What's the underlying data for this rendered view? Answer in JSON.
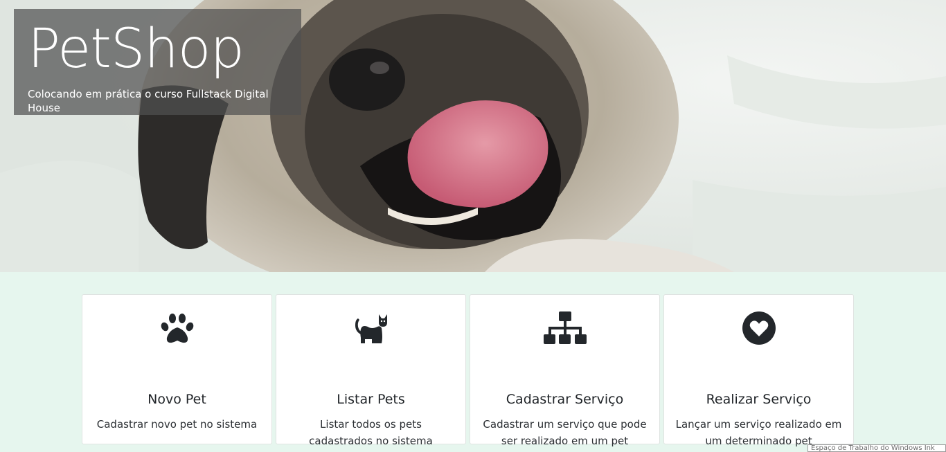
{
  "hero": {
    "title": "PetShop",
    "subtitle": "Colocando em prática o curso Fullstack Digital House"
  },
  "cards": [
    {
      "icon": "paw-icon",
      "title": "Novo Pet",
      "text": "Cadastrar novo pet no sistema"
    },
    {
      "icon": "cat-icon",
      "title": "Listar Pets",
      "text": "Listar todos os pets cadastrados no sistema"
    },
    {
      "icon": "sitemap-icon",
      "title": "Cadastrar Serviço",
      "text": "Cadastrar um serviço que pode ser realizado em um pet"
    },
    {
      "icon": "heart-circle-icon",
      "title": "Realizar Serviço",
      "text": "Lançar um serviço realizado em um determinado pet"
    }
  ],
  "taskbar": {
    "tooltip": "Espaço de Trabalho do Windows Ink"
  },
  "colors": {
    "page_background": "#e6f6ee",
    "hero_box": "#505050",
    "icon": "#23272b"
  }
}
